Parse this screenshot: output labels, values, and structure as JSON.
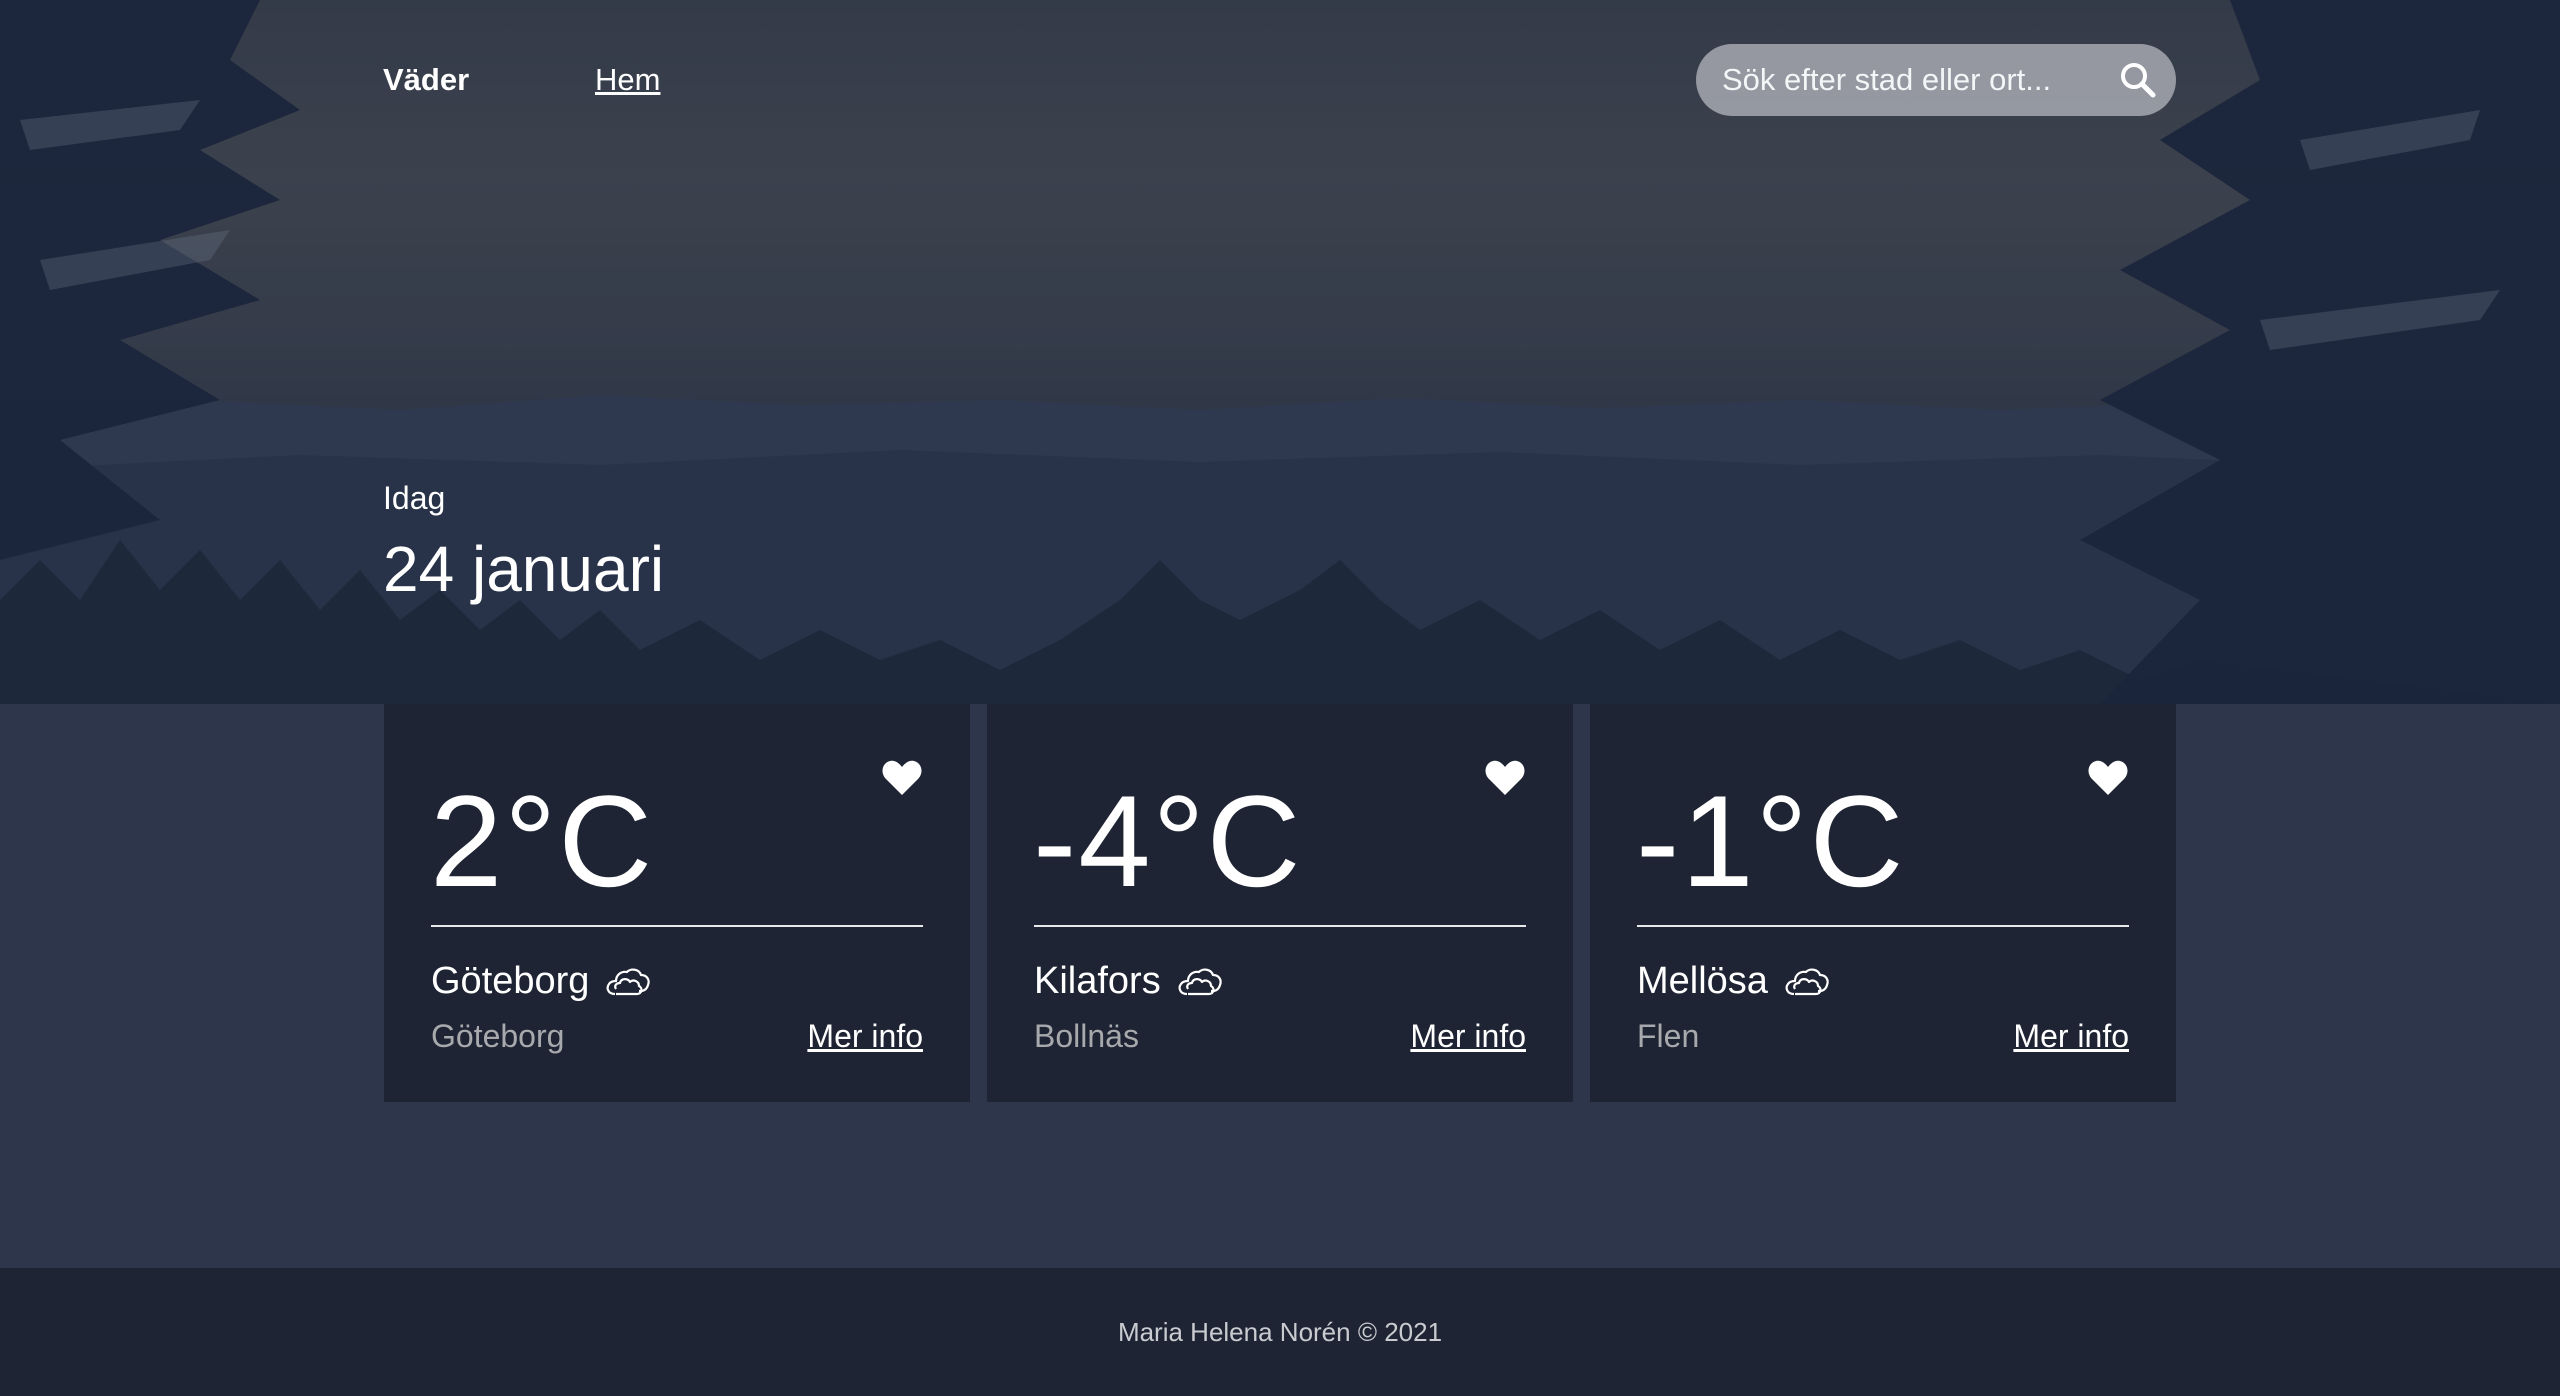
{
  "header": {
    "brand": "Väder",
    "nav_home": "Hem",
    "search_placeholder": "Sök efter stad eller ort..."
  },
  "hero": {
    "today_label": "Idag",
    "date": "24 januari"
  },
  "cards": [
    {
      "temp": "2°C",
      "city": "Göteborg",
      "region": "Göteborg",
      "more": "Mer info",
      "icon": "cloud-icon",
      "favorite_icon": "heart-icon"
    },
    {
      "temp": "-4°C",
      "city": "Kilafors",
      "region": "Bollnäs",
      "more": "Mer info",
      "icon": "cloud-icon",
      "favorite_icon": "heart-icon"
    },
    {
      "temp": "-1°C",
      "city": "Mellösa",
      "region": "Flen",
      "more": "Mer info",
      "icon": "cloud-icon",
      "favorite_icon": "heart-icon"
    }
  ],
  "footer": {
    "copyright": "Maria Helena Norén © 2021"
  },
  "colors": {
    "page_bg": "#2d364b",
    "card_bg": "#1e2433",
    "footer_bg": "#1e2433",
    "text": "#ffffff",
    "muted_text": "#a7a9ad"
  }
}
